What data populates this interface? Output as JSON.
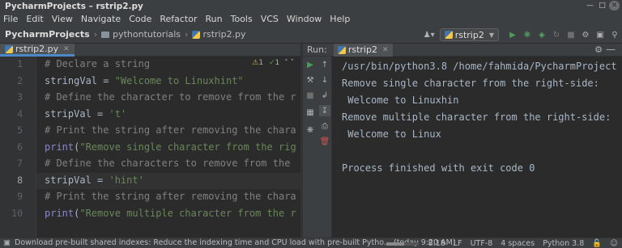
{
  "window": {
    "title": "PycharmProjects – rstrip2.py"
  },
  "menu": [
    "File",
    "Edit",
    "View",
    "Navigate",
    "Code",
    "Refactor",
    "Run",
    "Tools",
    "VCS",
    "Window",
    "Help"
  ],
  "breadcrumb": {
    "project": "PycharmProjects",
    "folder": "pythontutorials",
    "file": "rstrip2.py"
  },
  "toolbar": {
    "run_config": "rstrip2",
    "icons": [
      "user-icon",
      "run-icon",
      "debug-icon",
      "coverage-icon",
      "stop-icon",
      "wrench-icon",
      "layout-icon",
      "search-icon"
    ]
  },
  "editor": {
    "tab_label": "rstrip2.py",
    "inspection": {
      "warnings": "1",
      "ok": "1"
    },
    "current_line": 8,
    "lines": [
      {
        "no": "1",
        "parts": [
          {
            "t": "# Declare a string",
            "c": "com"
          }
        ]
      },
      {
        "no": "2",
        "parts": [
          {
            "t": "stringVal = ",
            "c": "id"
          },
          {
            "t": "\"Welcome to Linuxhint\"",
            "c": "str"
          }
        ]
      },
      {
        "no": "3",
        "parts": [
          {
            "t": "# Define the character to remove from the r",
            "c": "com"
          }
        ]
      },
      {
        "no": "4",
        "parts": [
          {
            "t": "stripVal = ",
            "c": "id"
          },
          {
            "t": "'t'",
            "c": "str"
          }
        ]
      },
      {
        "no": "5",
        "parts": [
          {
            "t": "# Print the string after removing the chara",
            "c": "com"
          }
        ]
      },
      {
        "no": "6",
        "parts": [
          {
            "t": "print",
            "c": "fn"
          },
          {
            "t": "(",
            "c": "id"
          },
          {
            "t": "\"Remove single character from the rig",
            "c": "str"
          }
        ]
      },
      {
        "no": "7",
        "parts": [
          {
            "t": "# Define the characters to remove from the",
            "c": "com"
          }
        ]
      },
      {
        "no": "8",
        "parts": [
          {
            "t": "stripVal = ",
            "c": "id"
          },
          {
            "t": "'hint'",
            "c": "str"
          }
        ]
      },
      {
        "no": "9",
        "parts": [
          {
            "t": "# Print the string after removing the chara",
            "c": "com"
          }
        ]
      },
      {
        "no": "10",
        "parts": [
          {
            "t": "print",
            "c": "fn"
          },
          {
            "t": "(",
            "c": "id"
          },
          {
            "t": "\"Remove multiple character from the r",
            "c": "str"
          }
        ]
      }
    ]
  },
  "run_panel": {
    "label": "Run:",
    "tab_label": "rstrip2",
    "output": [
      "/usr/bin/python3.8 /home/fahmida/PycharmProject",
      "Remove single character from the right-side:",
      " Welcome to Linuxhin",
      "Remove multiple character from the right-side:",
      " Welcome to Linux",
      "",
      "Process finished with exit code 0"
    ]
  },
  "status": {
    "message": "Download pre-built shared indexes: Reduce the indexing time and CPU load with pre-built Pytho... (today 9:20 AM)",
    "position": "8:18",
    "line_sep": "LF",
    "encoding": "UTF-8",
    "indent": "4 spaces",
    "interpreter": "Python 3.8",
    "indexing_progress": 0.55
  },
  "colors": {
    "accent": "#4a88c7",
    "run_green": "#499c54",
    "debug_green": "#59a869",
    "stop_red": "#c75450"
  }
}
